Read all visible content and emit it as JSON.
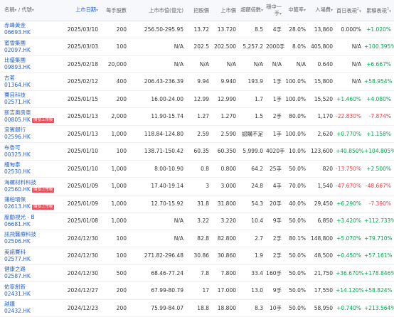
{
  "headers": {
    "name": "名稱",
    "code": "代號",
    "date": "上市日期",
    "lot": "每手股數",
    "cap": "上市市值(億元)",
    "price": "招股價",
    "listprice": "上市價",
    "oversub": "超額倍數",
    "lots": "穩中一手",
    "rate": "中籤率",
    "fee": "入場費",
    "day1": "首日表現",
    "cum": "累積表現"
  },
  "rows": [
    {
      "cn": "赤峰黃金",
      "code": "06693.HK",
      "tag": "",
      "date": "2025/03/10",
      "lot": "200",
      "cap": "256.50-295.95",
      "price": "13.72",
      "listprice": "13.720",
      "oversub": "8.5",
      "lots": "4手",
      "rate": "28.0%",
      "fee": "13,860",
      "day1": "0.000%",
      "day1dir": "flat",
      "cum": "+1.020%",
      "cumdir": "up"
    },
    {
      "cn": "蜜雪集團",
      "code": "02097.HK",
      "tag": "",
      "date": "2025/03/03",
      "lot": "100",
      "cap": "N/A",
      "price": "202.5",
      "listprice": "202.500",
      "oversub": "5,257.2",
      "lots": "2000手",
      "rate": "8.0%",
      "fee": "405,800",
      "day1": "N/A",
      "day1dir": "flat",
      "cum": "+100.395%",
      "cumdir": "up"
    },
    {
      "cn": "比優集團",
      "code": "09893.HK",
      "tag": "",
      "date": "2025/02/18",
      "lot": "20,000",
      "cap": "N/A",
      "price": "N/A",
      "listprice": "N/A",
      "oversub": "N/A",
      "lots": "N/A",
      "rate": "N/A",
      "fee": "0.640",
      "day1": "N/A",
      "day1dir": "flat",
      "cum": "+6.667%",
      "cumdir": "up"
    },
    {
      "cn": "古茗",
      "code": "01364.HK",
      "tag": "",
      "date": "2025/02/12",
      "lot": "400",
      "cap": "206.43-236.39",
      "price": "9.94",
      "listprice": "9.940",
      "oversub": "193.9",
      "lots": "1手",
      "rate": "100.0%",
      "fee": "15,800",
      "day1": "N/A",
      "day1dir": "flat",
      "cum": "+58.954%",
      "cumdir": "up"
    },
    {
      "cn": "賽目科技",
      "code": "02571.HK",
      "tag": "",
      "date": "2025/01/15",
      "lot": "200",
      "cap": "16.00-24.00",
      "price": "12.99",
      "listprice": "12.990",
      "oversub": "1.7",
      "lots": "1手",
      "rate": "100.0%",
      "fee": "15,520",
      "day1": "+1.460%",
      "day1dir": "up",
      "cum": "+4.080%",
      "cumdir": "up"
    },
    {
      "cn": "新吉奧房車",
      "code": "00805.HK",
      "tag": "價發上市後",
      "date": "2025/01/13",
      "lot": "2,000",
      "cap": "11.90-15.74",
      "price": "1.27",
      "listprice": "1.270",
      "oversub": "1.5",
      "lots": "2手",
      "rate": "80.0%",
      "fee": "1,170",
      "day1": "-22.830%",
      "day1dir": "down",
      "cum": "-7.874%",
      "cumdir": "down"
    },
    {
      "cn": "宜賓銀行",
      "code": "02596.HK",
      "tag": "",
      "date": "2025/01/13",
      "lot": "1,000",
      "cap": "118.84-124.80",
      "price": "2.59",
      "listprice": "2.590",
      "oversub": "認購不足",
      "lots": "1手",
      "rate": "100.0%",
      "fee": "2,620",
      "day1": "+0.770%",
      "day1dir": "up",
      "cum": "+1.158%",
      "cumdir": "up"
    },
    {
      "cn": "布魯可",
      "code": "00325.HK",
      "tag": "",
      "date": "2025/01/10",
      "lot": "100",
      "cap": "138.71-150.42",
      "price": "60.35",
      "listprice": "60.350",
      "oversub": "5,999.0",
      "lots": "4020手",
      "rate": "10.0%",
      "fee": "123,600",
      "day1": "+40.850%",
      "day1dir": "up",
      "cum": "+104.805%",
      "cumdir": "up"
    },
    {
      "cn": "緬甸泰",
      "code": "02530.HK",
      "tag": "",
      "date": "2025/01/10",
      "lot": "1,000",
      "cap": "8.00-10.90",
      "price": "0.8",
      "listprice": "0.800",
      "oversub": "64.2",
      "lots": "25手",
      "rate": "50.0%",
      "fee": "820",
      "day1": "-13.750%",
      "day1dir": "down",
      "cum": "+2.500%",
      "cumdir": "up"
    },
    {
      "cn": "海螺材料科技",
      "code": "02560.HK",
      "tag": "價發上市後",
      "date": "2025/01/09",
      "lot": "1,000",
      "cap": "17.40-19.14",
      "price": "3",
      "listprice": "3.000",
      "oversub": "24.8",
      "lots": "4手",
      "rate": "70.0%",
      "fee": "1,540",
      "day1": "-47.670%",
      "day1dir": "down",
      "cum": "-48.667%",
      "cumdir": "down"
    },
    {
      "cn": "蒲柏環保",
      "code": "02613.HK",
      "tag": "價發上市後",
      "date": "2025/01/09",
      "lot": "1,000",
      "cap": "12.70-15.92",
      "price": "31.8",
      "listprice": "31.800",
      "oversub": "54.3",
      "lots": "20手",
      "rate": "40.0%",
      "fee": "29,450",
      "day1": "+6.290%",
      "day1dir": "up",
      "cum": "-7.390%",
      "cumdir": "down"
    },
    {
      "cn": "脈動視光 - B",
      "code": "06681.HK",
      "tag": "",
      "date": "2025/01/08",
      "lot": "1,000",
      "cap": "N/A",
      "price": "3.22",
      "listprice": "3.220",
      "oversub": "10.4",
      "lots": "9手",
      "rate": "50.0%",
      "fee": "6,850",
      "day1": "+3.420%",
      "day1dir": "up",
      "cum": "+112.733%",
      "cumdir": "up"
    },
    {
      "cn": "訊飛醫療科技",
      "code": "02506.HK",
      "tag": "",
      "date": "2024/12/30",
      "lot": "100",
      "cap": "N/A",
      "price": "82.8",
      "listprice": "82.800",
      "oversub": "2.7",
      "lots": "2手",
      "rate": "80.1%",
      "fee": "148,800",
      "day1": "+5.070%",
      "day1dir": "up",
      "cum": "+79.710%",
      "cumdir": "up"
    },
    {
      "cn": "英諾賽科",
      "code": "02577.HK",
      "tag": "",
      "date": "2024/12/30",
      "lot": "100",
      "cap": "271.82-296.48",
      "price": "30.86",
      "listprice": "30.860",
      "oversub": "1.9",
      "lots": "2手",
      "rate": "50.0%",
      "fee": "48,500",
      "day1": "+0.450%",
      "day1dir": "up",
      "cum": "+57.161%",
      "cumdir": "up"
    },
    {
      "cn": "健康之路",
      "code": "02587.HK",
      "tag": "",
      "date": "2024/12/30",
      "lot": "500",
      "cap": "68.46-77.24",
      "price": "7.8",
      "listprice": "7.800",
      "oversub": "33.4",
      "lots": "160手",
      "rate": "50.0%",
      "fee": "21,750",
      "day1": "+36.670%",
      "day1dir": "up",
      "cum": "+178.846%",
      "cumdir": "up"
    },
    {
      "cn": "佑寧創新",
      "code": "02431.HK",
      "tag": "",
      "date": "2024/12/27",
      "lot": "200",
      "cap": "67.99-80.79",
      "price": "17",
      "listprice": "17.000",
      "oversub": "13.0",
      "lots": "9手",
      "rate": "50.0%",
      "fee": "17,550",
      "day1": "+14.120%",
      "day1dir": "up",
      "cum": "+58.824%",
      "cumdir": "up"
    },
    {
      "cn": "越疆",
      "code": "02432.HK",
      "tag": "",
      "date": "2024/12/23",
      "lot": "200",
      "cap": "75.99-84.07",
      "price": "18.8",
      "listprice": "18.800",
      "oversub": "8.3",
      "lots": "10手",
      "rate": "50.0%",
      "fee": "58,950",
      "day1": "+0.740%",
      "day1dir": "up",
      "cum": "+213.564%",
      "cumdir": "up"
    }
  ]
}
